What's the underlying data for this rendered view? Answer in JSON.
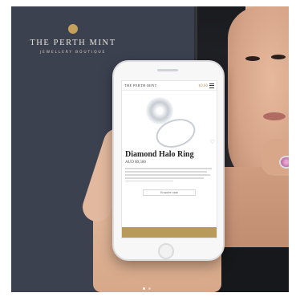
{
  "brand": {
    "title": "THE PERTH MINT",
    "subtitle": "JEWELLERY BOUTIQUE"
  },
  "app": {
    "header_logo": "THE PERTH MINT",
    "cart_total": "$0.00"
  },
  "product": {
    "title": "Diamond Halo Ring",
    "price": "AUD $9,500",
    "primary_button": "Enquire now"
  },
  "carousel": {
    "current_index": 1,
    "count": 2
  }
}
